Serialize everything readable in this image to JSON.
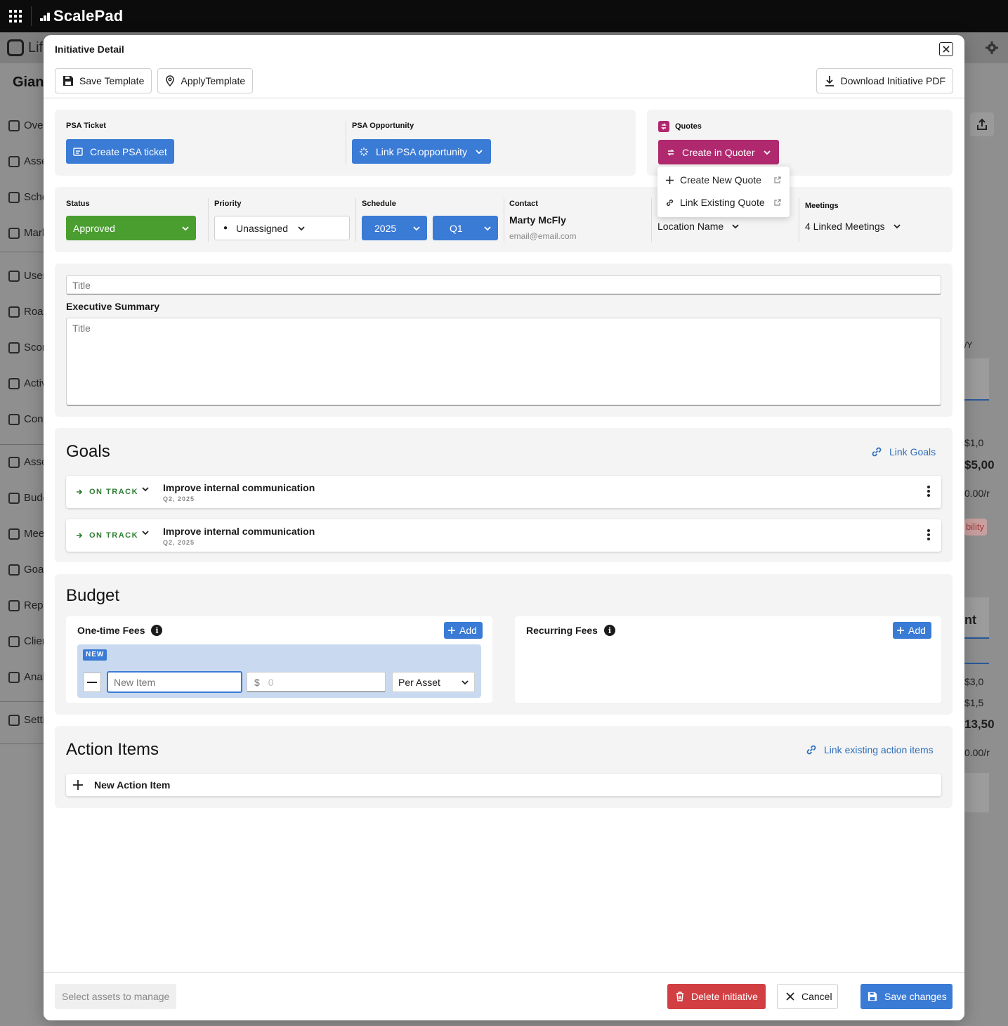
{
  "app": {
    "brand": "ScalePad",
    "sub_brand_partial": "Lif",
    "client_partial": "Giant"
  },
  "background": {
    "sidebar": [
      "Over",
      "Asse",
      "Sche",
      "Mark",
      "User",
      "Roac",
      "Scor",
      "Activ",
      "Cont",
      "Asse",
      "Budg",
      "Meet",
      "Goal",
      "Repo",
      "Clier",
      "Anal",
      "Setti"
    ],
    "right": [
      "/Y",
      "$1,0",
      "$5,00",
      "0.00/r",
      "bility",
      "nt",
      "$3,0",
      "$1,5",
      "13,50",
      "0.00/r"
    ]
  },
  "modal": {
    "title": "Initiative Detail",
    "toolbar": {
      "save_template": "Save Template",
      "apply_template": "ApplyTemplate",
      "download_pdf": "Download Initiative PDF"
    },
    "psa": {
      "ticket_label": "PSA Ticket",
      "ticket_button": "Create PSA ticket",
      "opportunity_label": "PSA Opportunity",
      "opportunity_button": "Link PSA opportunity"
    },
    "quotes": {
      "label": "Quotes",
      "button": "Create in Quoter",
      "menu": [
        "Create New Quote",
        "Link Existing Quote"
      ]
    },
    "meta": {
      "status_label": "Status",
      "status_value": "Approved",
      "priority_label": "Priority",
      "priority_value": "Unassigned",
      "schedule_label": "Schedule",
      "schedule_year": "2025",
      "schedule_quarter": "Q1",
      "contact_label": "Contact",
      "contact_name": "Marty McFly",
      "contact_email": "email@email.com",
      "location_value": "Location Name",
      "meetings_label": "Meetings",
      "meetings_value": "4 Linked Meetings"
    },
    "summary": {
      "title_placeholder": "Title",
      "exec_label": "Executive Summary",
      "exec_placeholder": "Title"
    },
    "goals": {
      "heading": "Goals",
      "link": "Link Goals",
      "items": [
        {
          "status": "ON TRACK",
          "title": "Improve internal communication",
          "sub": "Q2, 2025"
        },
        {
          "status": "ON TRACK",
          "title": "Improve internal communication",
          "sub": "Q2, 2025"
        }
      ]
    },
    "budget": {
      "heading": "Budget",
      "one_time": "One-time Fees",
      "recurring": "Recurring Fees",
      "add": "Add",
      "new_badge": "NEW",
      "item_placeholder": "New Item",
      "currency": "$",
      "amount_placeholder": "0",
      "per": "Per Asset"
    },
    "actions": {
      "heading": "Action Items",
      "link": "Link existing action items",
      "new": "New Action Item"
    },
    "footer": {
      "assets": "Select assets to manage",
      "delete": "Delete initiative",
      "cancel": "Cancel",
      "save": "Save changes"
    }
  },
  "colors": {
    "blue": "#3a7bd5",
    "green": "#4a9e2f",
    "magenta": "#b0296e",
    "red": "#d23f43",
    "link": "#2f6fba"
  }
}
